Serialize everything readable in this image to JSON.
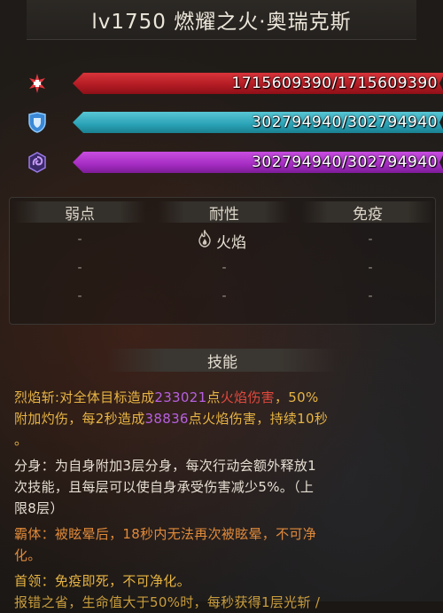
{
  "title": "lv1750  燃耀之火·奥瑞克斯",
  "bars": {
    "hp": "1715609390/1715609390",
    "shield": "302794940/302794940",
    "energy": "302794940/302794940"
  },
  "resist": {
    "headers": [
      "弱点",
      "耐性",
      "免疫"
    ],
    "dash": "-",
    "fire_label": "火焰"
  },
  "skills_header": "技能",
  "skills": {
    "s1": {
      "name": "烈焰斩:",
      "p1": "对全体目标造成",
      "v1": "233021",
      "p2": "点",
      "dmg": "火焰伤害",
      "p3": "，50%",
      "line2a": "附加灼伤，每2秒造成",
      "v2": "38836",
      "line2b": "点火焰伤害，持续10秒",
      "end": "。"
    },
    "s2": {
      "l1": "分身：为自身附加3层分身，每次行动会额外释放1",
      "l2": "次技能，且每层可以使自身承受伤害减少5%。（上",
      "l3": "限8层）"
    },
    "s3": {
      "l1": "霸体：被眩晕后，18秒内无法再次被眩晕，不可净",
      "l2": "化。"
    },
    "s4": {
      "l1": "首领：免疫即死，不可净化。"
    },
    "s5": {
      "l1": "报错之省，生命值大于50%时，每秒获得1层光斩 /"
    }
  },
  "colors": {
    "hp": "#c8242c",
    "shield": "#2aa2b6",
    "energy": "#a52cc2",
    "accent_yellow": "#e7b443",
    "accent_purple": "#b760e0",
    "accent_red": "#e0493e"
  },
  "icons": [
    "health-cross-icon",
    "shield-icon",
    "energy-swirl-icon",
    "fire-icon"
  ]
}
